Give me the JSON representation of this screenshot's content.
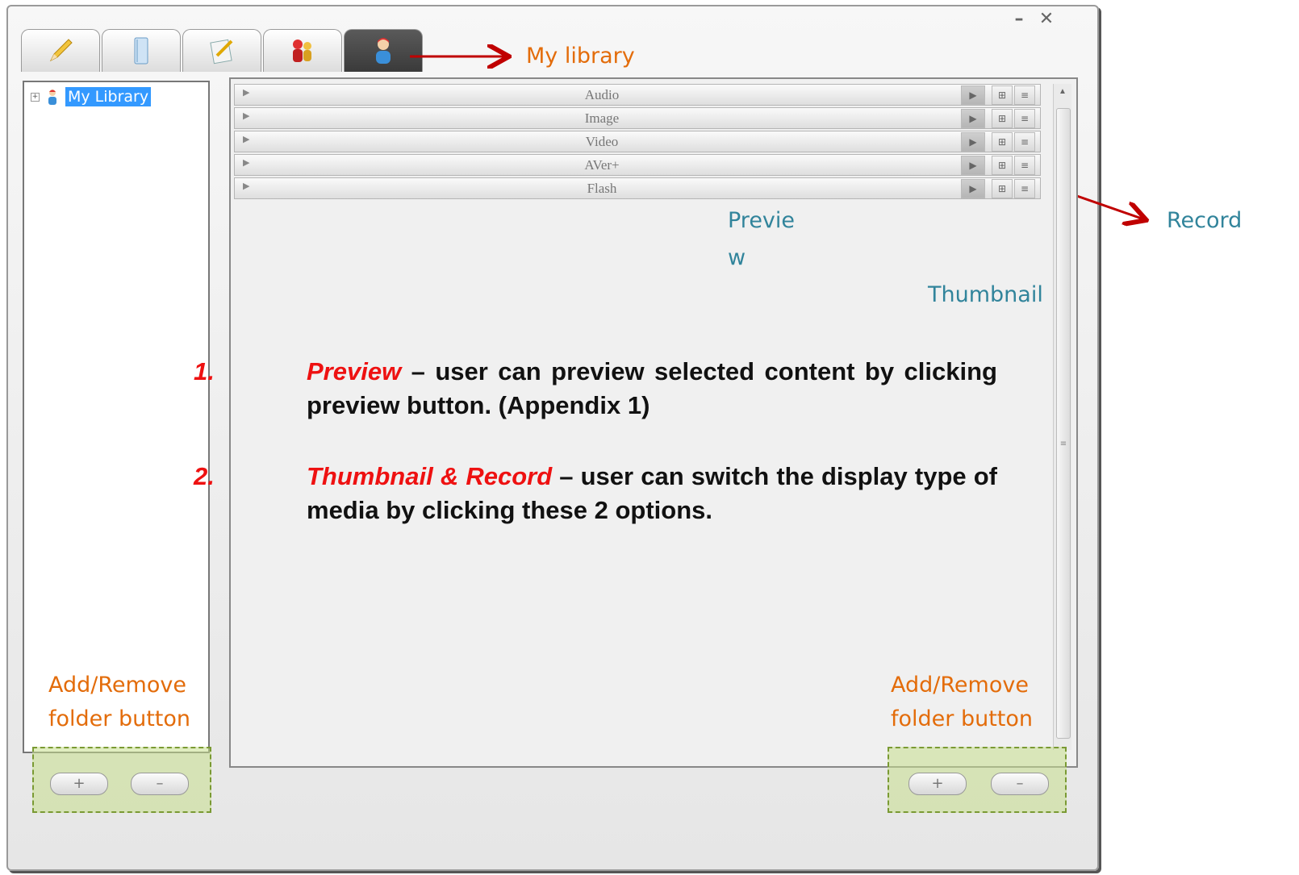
{
  "window": {
    "minimize_icon": "minimize-icon",
    "close_icon": "close-icon",
    "minimize_glyph": "–",
    "close_glyph": "✕"
  },
  "tabs": [
    {
      "icon": "pencil-icon"
    },
    {
      "icon": "book-icon"
    },
    {
      "icon": "edit-document-icon"
    },
    {
      "icon": "people-icon"
    },
    {
      "icon": "user-library-icon",
      "active": true
    }
  ],
  "tree": {
    "expander": "+",
    "label": "My Library"
  },
  "media_rows": [
    {
      "label": "Audio"
    },
    {
      "label": "Image"
    },
    {
      "label": "Video"
    },
    {
      "label": "AVer+"
    },
    {
      "label": "Flash"
    }
  ],
  "row_glyphs": {
    "expand": "▶",
    "preview": "▶",
    "thumbnail": "⊞",
    "record": "≡"
  },
  "scrollbar": {
    "up": "▲",
    "grip": "≡"
  },
  "annotations": {
    "my_library": "My library",
    "preview_line1": "Previe",
    "preview_line2": "w",
    "thumbnail": "Thumbnail",
    "record": "Record",
    "add_remove_left_1": "Add/Remove",
    "add_remove_left_2": "folder button",
    "add_remove_right_1": "Add/Remove",
    "add_remove_right_2": "folder button"
  },
  "notes": [
    {
      "num": "1.",
      "term": "Preview",
      "text": " – user can preview selected content by clicking preview button. (Appendix 1)"
    },
    {
      "num": "2.",
      "term": "Thumbnail & Record",
      "text": " – user can switch the display type of media by clicking these 2 options."
    }
  ],
  "buttons": {
    "add": "+",
    "remove": "–"
  },
  "colors": {
    "annotation_orange": "#e36c0a",
    "annotation_teal": "#31849b",
    "arrow": "#c00000",
    "emphasis_red": "#ee1111"
  }
}
